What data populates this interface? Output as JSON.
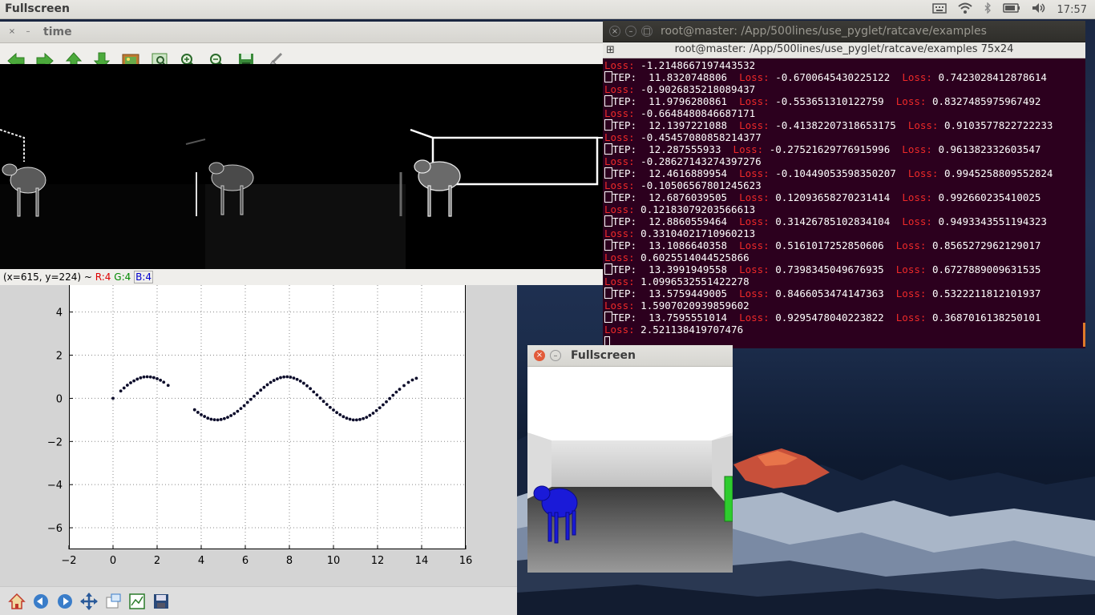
{
  "topbar": {
    "title": "Fullscreen",
    "tray_icons": [
      "keyboard-icon",
      "wifi-icon",
      "bluetooth-icon",
      "battery-icon",
      "volume-icon"
    ],
    "clock": "17:57"
  },
  "viewer": {
    "title": "time",
    "close_label": "×",
    "minimize_label": "–",
    "toolbar_icons": [
      "back-arrow-icon",
      "forward-arrow-icon",
      "up-arrow-icon",
      "down-arrow-icon",
      "image-icon",
      "zoom-fit-icon",
      "zoom-in-icon",
      "zoom-out-icon",
      "save-icon",
      "brush-icon"
    ],
    "status": {
      "coords": "(x=615, y=224) ~ ",
      "r": "R:4",
      "g": "G:4",
      "b": "B:4"
    }
  },
  "terminal": {
    "title": "root@master: /App/500lines/use_pyglet/ratcave/examples",
    "header": "root@master: /App/500lines/use_pyglet/ratcave/examples 75x24",
    "close_label": "×",
    "minimize_label": "–",
    "maximize_label": "□",
    "first_loss": "-1.2148667197443532",
    "step_label": "TEP:",
    "loss_label": "Loss:",
    "rows": [
      {
        "step": "11.8320748806",
        "loss1": "-0.6700645430225122",
        "loss2": "0.7423028412878614",
        "loss3": "-0.9026835218089437"
      },
      {
        "step": "11.9796280861",
        "loss1": "-0.553651310122759",
        "loss2": "0.8327485975967492",
        "loss3": "-0.6648480846687171"
      },
      {
        "step": "12.1397221088",
        "loss1": "-0.41382207318653175",
        "loss2": "0.9103577822722233",
        "loss3": "-0.45457080858214377"
      },
      {
        "step": "12.287555933",
        "loss1": "-0.27521629776915996",
        "loss2": "0.961382332603547",
        "loss3": "-0.28627143274397276"
      },
      {
        "step": "12.4616889954",
        "loss1": "-0.10449053598350207",
        "loss2": "0.9945258809552824",
        "loss3": "-0.10506567801245623"
      },
      {
        "step": "12.6876039505",
        "loss1": "0.12093658270231414",
        "loss2": "0.992660235410025",
        "loss3": "0.12183079203566613"
      },
      {
        "step": "12.8860559464",
        "loss1": "0.31426785102834104",
        "loss2": "0.9493343551194323",
        "loss3": "0.33104021710960213"
      },
      {
        "step": "13.1086640358",
        "loss1": "0.5161017252850606",
        "loss2": "0.8565272962129017",
        "loss3": "0.6025514044525866"
      },
      {
        "step": "13.3991949558",
        "loss1": "0.7398345049676935",
        "loss2": "0.6727889009631535",
        "loss3": "1.0996532551422278"
      },
      {
        "step": "13.5759449005",
        "loss1": "0.8466053474147363",
        "loss2": "0.5322211812101937",
        "loss3": "1.5907020939859602"
      },
      {
        "step": "13.7595551014",
        "loss1": "0.9295478040223822",
        "loss2": "0.3687016138250101",
        "loss3": "2.521138419707476"
      }
    ]
  },
  "fullscreen_window": {
    "title": "Fullscreen",
    "close_label": "×",
    "minimize_label": "–"
  },
  "plot_window": {
    "nav_icons": [
      "home-icon",
      "back-icon",
      "forward-icon",
      "pan-icon",
      "zoom-rect-icon",
      "subplots-icon",
      "save-icon"
    ]
  },
  "chart_data": {
    "type": "scatter",
    "title": "",
    "xlabel": "",
    "ylabel": "",
    "xlim": [
      -2,
      16
    ],
    "ylim": [
      -7,
      5
    ],
    "grid": true,
    "xticks": [
      "−2",
      "0",
      "2",
      "4",
      "6",
      "8",
      "10",
      "12",
      "14",
      "16"
    ],
    "yticks": [
      "4",
      "2",
      "0",
      "−2",
      "−4",
      "−6"
    ],
    "color": "#0b0b2a",
    "x": [
      0,
      0.35,
      0.5,
      0.65,
      0.8,
      0.95,
      1.1,
      1.25,
      1.4,
      1.55,
      1.7,
      1.85,
      2.0,
      2.15,
      2.3,
      2.5,
      3.7,
      3.85,
      4.0,
      4.15,
      4.3,
      4.45,
      4.6,
      4.75,
      4.9,
      5.05,
      5.2,
      5.35,
      5.5,
      5.65,
      5.8,
      5.95,
      6.1,
      6.25,
      6.4,
      6.55,
      6.7,
      6.85,
      7.0,
      7.15,
      7.3,
      7.45,
      7.6,
      7.75,
      7.9,
      8.05,
      8.2,
      8.35,
      8.5,
      8.65,
      8.8,
      8.95,
      9.1,
      9.25,
      9.4,
      9.55,
      9.7,
      9.85,
      10.0,
      10.15,
      10.3,
      10.45,
      10.6,
      10.75,
      10.9,
      11.05,
      11.2,
      11.35,
      11.5,
      11.65,
      11.8,
      11.95,
      12.1,
      12.25,
      12.4,
      12.55,
      12.7,
      12.85,
      13.0,
      13.2,
      13.4,
      13.58,
      13.76
    ],
    "y": [
      0,
      0.34,
      0.48,
      0.61,
      0.72,
      0.81,
      0.89,
      0.95,
      0.99,
      1.0,
      0.99,
      0.96,
      0.91,
      0.84,
      0.75,
      0.6,
      -0.53,
      -0.65,
      -0.76,
      -0.84,
      -0.92,
      -0.97,
      -0.99,
      -1.0,
      -0.98,
      -0.94,
      -0.88,
      -0.8,
      -0.71,
      -0.6,
      -0.47,
      -0.34,
      -0.19,
      -0.05,
      0.1,
      0.24,
      0.38,
      0.51,
      0.63,
      0.74,
      0.83,
      0.9,
      0.96,
      0.99,
      1.0,
      0.98,
      0.94,
      0.88,
      0.8,
      0.7,
      0.58,
      0.45,
      0.3,
      0.16,
      0.01,
      -0.14,
      -0.28,
      -0.42,
      -0.54,
      -0.66,
      -0.76,
      -0.85,
      -0.92,
      -0.97,
      -1.0,
      -1.0,
      -0.98,
      -0.94,
      -0.88,
      -0.79,
      -0.69,
      -0.57,
      -0.44,
      -0.3,
      -0.16,
      -0.01,
      0.14,
      0.29,
      0.42,
      0.59,
      0.74,
      0.85,
      0.93
    ]
  }
}
